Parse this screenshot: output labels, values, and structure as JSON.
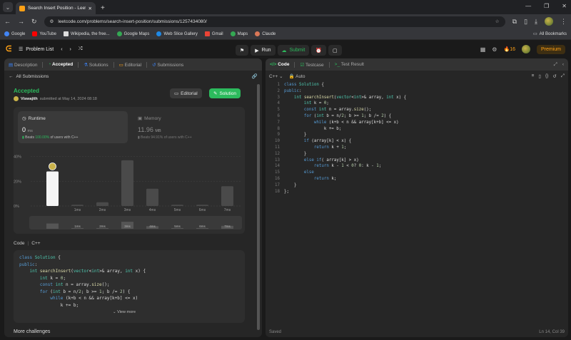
{
  "browser": {
    "tab_title": "Search Insert Position - LeetCo",
    "url": "leetcode.com/problems/search-insert-position/submissions/1257434080/",
    "bookmarks": [
      "Google",
      "YouTube",
      "Wikipedia, the free...",
      "Google Maps",
      "Web Slice Gallery",
      "Gmail",
      "Maps",
      "Claude"
    ],
    "all_bookmarks": "All Bookmarks"
  },
  "nav": {
    "problem_list": "Problem List",
    "run": "Run",
    "submit": "Submit",
    "streak": "16",
    "premium": "Premium"
  },
  "left_tabs": [
    "Description",
    "Accepted",
    "Solutions",
    "Editorial",
    "Submissions"
  ],
  "all_submissions": "All Submissions",
  "result": {
    "status": "Accepted",
    "user": "Viswajith",
    "submitted": "submitted at May 14, 2024 08:18",
    "editorial_btn": "Editorial",
    "solution_btn": "Solution"
  },
  "runtime": {
    "label": "Runtime",
    "value": "0",
    "unit": "ms",
    "beats_prefix": "Beats",
    "beats_pct": "100.00%",
    "beats_suffix": "of users with C++"
  },
  "memory": {
    "label": "Memory",
    "value": "11.96",
    "unit": "MB",
    "beats_prefix": "Beats",
    "beats_pct": "94.91%",
    "beats_suffix": "of users with C++"
  },
  "chart_data": {
    "type": "bar",
    "categories": [
      "",
      "1ms",
      "2ms",
      "3ms",
      "4ms",
      "5ms",
      "6ms",
      "7ms"
    ],
    "values": [
      28,
      1,
      3,
      37,
      14,
      1,
      1,
      16
    ],
    "highlight_index": 0,
    "ytick_labels": [
      "40%",
      "20%",
      "0%"
    ],
    "ylim": [
      0,
      45
    ],
    "minimap_labels": [
      "1ms",
      "2ms",
      "3ms",
      "4ms",
      "5ms",
      "6ms",
      "7ms"
    ]
  },
  "code_label": "Code",
  "code_lang": "C++",
  "preview_code": [
    "class Solution {",
    "public:",
    "    int searchInsert(vector<int>& array, int x) {",
    "        int k = 0;",
    "        const int n = array.size();",
    "        for (int b = n/2; b >= 1; b /= 2) {",
    "            while (k+b < n && array[k+b] <= x)",
    "                k += b;"
  ],
  "view_more": "View more",
  "more_challenges": "More challenges",
  "editor": {
    "tab_code": "Code",
    "tab_testcase": "Testcase",
    "tab_result": "Test Result",
    "lang": "C++",
    "mode": "Auto",
    "lines": [
      "class Solution {",
      "public:",
      "    int searchInsert(vector<int>& array, int x) {",
      "        int k = 0;",
      "        const int n = array.size();",
      "        for (int b = n/2; b >= 1; b /= 2) {",
      "            while (k+b < n && array[k+b] <= x)",
      "                k += b;",
      "        }",
      "        if (array[k] < x) {",
      "            return k + 1;",
      "        }",
      "        else if( array[k] > x)",
      "            return k - 1 < 0? 0: k - 1;",
      "        else",
      "            return k;",
      "    }",
      "};"
    ],
    "status_left": "Saved",
    "status_right": "Ln 14, Col 39"
  }
}
